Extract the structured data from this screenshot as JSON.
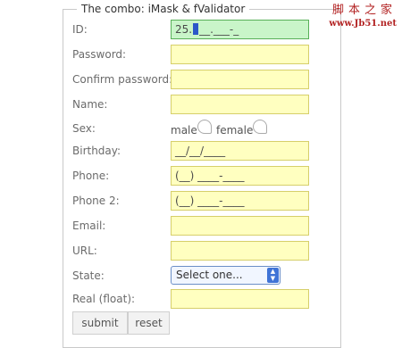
{
  "form": {
    "legend": "The combo: iMask & fValidator",
    "fields": [
      {
        "label": "ID:",
        "value_before_cursor": "25.",
        "value_after_cursor": "__.___-_"
      },
      {
        "label": "Password:",
        "value": ""
      },
      {
        "label": "Confirm password:",
        "value": ""
      },
      {
        "label": "Name:",
        "value": ""
      },
      {
        "label": "Sex:",
        "options": [
          "male",
          "female"
        ]
      },
      {
        "label": "Birthday:",
        "value": "__/__/____"
      },
      {
        "label": "Phone:",
        "value": "(__) ____-____"
      },
      {
        "label": "Phone 2:",
        "value": "(__) ____-____"
      },
      {
        "label": "Email:",
        "value": ""
      },
      {
        "label": "URL:",
        "value": ""
      },
      {
        "label": "State:",
        "selected": "Select one..."
      },
      {
        "label": "Real (float):",
        "value": ""
      }
    ],
    "submit_label": "submit",
    "reset_label": "reset"
  },
  "watermark": {
    "title": "脚本之家",
    "url": "www.Jb51.net"
  },
  "colors": {
    "field_bg": "#ffffc0",
    "active_field_bg": "#c9f5c9",
    "watermark": "#b22222"
  }
}
